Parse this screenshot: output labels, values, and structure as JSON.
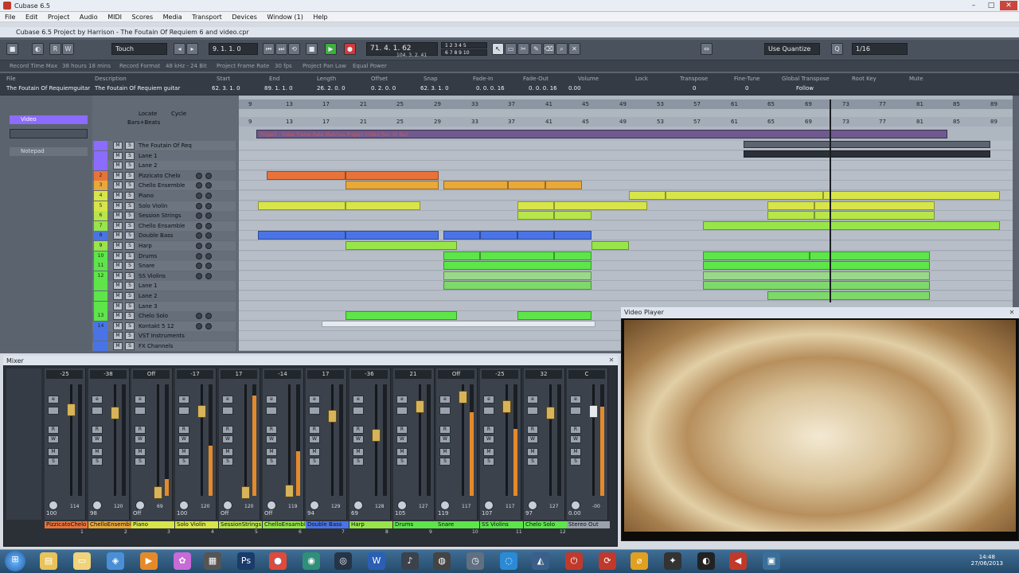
{
  "app": {
    "title": "Cubase 6.5",
    "window_controls": [
      "–",
      "□",
      "✕"
    ]
  },
  "menubar": {
    "items": [
      "File",
      "Edit",
      "Project",
      "Audio",
      "MIDI",
      "Scores",
      "Media",
      "Transport",
      "Devices",
      "Window (1)",
      "Help"
    ]
  },
  "project": {
    "title": "Cubase 6.5 Project by Harrison - The Foutain Of Requiem 6 and video.cpr",
    "toolbar": {
      "automation_mode": "Touch",
      "position_primary": "9. 1. 1. 0",
      "position_secondary": "89. 1. 1. 0",
      "main_position": "71. 4. 1. 62",
      "main_position_sub": "104. 3. 2. 41",
      "markers_row1": "1 2 3 4 5",
      "markers_row2": "6 7 8 9 10",
      "quantize_mode": "Use Quantize",
      "quantize_value": "1/16"
    },
    "status_bar": {
      "record_time_label": "Record Time Max",
      "record_time_value": "38 hours 18 mins",
      "record_format_label": "Record Format",
      "record_format_value": "48 kHz - 24 Bit",
      "frame_rate_label": "Project Frame Rate",
      "frame_rate_value": "30 fps",
      "pan_law_label": "Project Pan Law",
      "pan_law_value": "Equal Power"
    },
    "infoline": {
      "headers": [
        "File",
        "Description",
        "Start",
        "End",
        "Length",
        "Offset",
        "Snap",
        "Fade-In",
        "Fade-Out",
        "Volume",
        "Lock",
        "Transpose",
        "Fine-Tune",
        "Global Transpose",
        "Root Key",
        "Mute"
      ],
      "values": [
        "The Foutain Of Requiemguitar",
        "The Foutain Of Requiem guitar",
        "62. 3. 1. 0",
        "89. 1. 1. 0",
        "26. 2. 0. 0",
        "0. 2. 0. 0",
        "62. 3. 1. 0",
        "0. 0. 0. 16",
        "0. 0. 0. 16",
        "0.00",
        "",
        "0",
        "0",
        "Follow",
        "",
        ""
      ]
    },
    "inspector": {
      "video_tab": "Video",
      "notepad_tab": "Notepad"
    },
    "track_list_header": {
      "locate": "Locate",
      "cycle": "Cycle",
      "ruler_format": "Bars+Beats"
    },
    "tracks": [
      {
        "num": "",
        "name": "The Foutain Of Req",
        "color": "#8b6cff"
      },
      {
        "num": "",
        "name": "Lane 1",
        "color": "#8b6cff"
      },
      {
        "num": "",
        "name": "Lane 2",
        "color": "#8b6cff"
      },
      {
        "num": "2",
        "name": "Pizzicato Chelo",
        "color": "#e8733a"
      },
      {
        "num": "3",
        "name": "Chello Ensemble",
        "color": "#e8a83a"
      },
      {
        "num": "4",
        "name": "Piano",
        "color": "#d8e54a"
      },
      {
        "num": "5",
        "name": "Solo Violin",
        "color": "#d8e54a"
      },
      {
        "num": "6",
        "name": "Session Strings",
        "color": "#b8e54a"
      },
      {
        "num": "7",
        "name": "Chello Ensamble",
        "color": "#98e54a"
      },
      {
        "num": "8",
        "name": "Double Bass",
        "color": "#4a74e5"
      },
      {
        "num": "9",
        "name": "Harp",
        "color": "#98e54a"
      },
      {
        "num": "10",
        "name": "Drums",
        "color": "#5ee54a"
      },
      {
        "num": "11",
        "name": "Snare",
        "color": "#5ee54a"
      },
      {
        "num": "12",
        "name": "SS Violins",
        "color": "#5ee54a"
      },
      {
        "num": "",
        "name": "Lane 1",
        "color": "#5ee54a"
      },
      {
        "num": "",
        "name": "Lane 2",
        "color": "#5ee54a"
      },
      {
        "num": "",
        "name": "Lane 3",
        "color": "#5ee54a"
      },
      {
        "num": "13",
        "name": "Chelo Solo",
        "color": "#5ee54a"
      },
      {
        "num": "14",
        "name": "Kontakt 5 12",
        "color": "#4a74e5"
      },
      {
        "num": "",
        "name": "VST Instruments",
        "color": "#4a74e5"
      },
      {
        "num": "",
        "name": "FX Channels",
        "color": "#4a74e5"
      }
    ],
    "ruler_bars": [
      "9",
      "13",
      "17",
      "21",
      "25",
      "29",
      "33",
      "37",
      "41",
      "45",
      "49",
      "53",
      "57",
      "61",
      "65",
      "69",
      "73",
      "77",
      "81",
      "85",
      "89"
    ],
    "video_track_label": "Project - Video Frame Rate Matches Project (Video fps: 30 fps)"
  },
  "mixer": {
    "title": "Mixer",
    "channels": [
      {
        "name": "PizzicatoChelo",
        "num": "1",
        "top_vol": "-25",
        "bottom_a": "100",
        "bottom_b": "114",
        "color": "#e8733a",
        "meter": 0.0
      },
      {
        "name": "ChelloEnsembl",
        "num": "2",
        "top_vol": "-38",
        "bottom_a": "98",
        "bottom_b": "120",
        "color": "#e8a83a",
        "meter": 0.0
      },
      {
        "name": "Piano",
        "num": "3",
        "top_vol": "Off",
        "bottom_a": "Off",
        "bottom_b": "69",
        "color": "#d8e54a",
        "meter": 0.15
      },
      {
        "name": "Solo Violin",
        "num": "4",
        "top_vol": "-17",
        "bottom_a": "100",
        "bottom_b": "120",
        "color": "#d8e54a",
        "meter": 0.45
      },
      {
        "name": "SessionStrings",
        "num": "5",
        "top_vol": "17",
        "bottom_a": "Off",
        "bottom_b": "120",
        "color": "#b8e54a",
        "meter": 0.9
      },
      {
        "name": "ChelloEnsambl",
        "num": "6",
        "top_vol": "-14",
        "bottom_a": "Off",
        "bottom_b": "119",
        "color": "#98e54a",
        "meter": 0.4
      },
      {
        "name": "Double Bass",
        "num": "7",
        "top_vol": "17",
        "bottom_a": "94",
        "bottom_b": "129",
        "color": "#4a74e5",
        "meter": 0.0
      },
      {
        "name": "Harp",
        "num": "8",
        "top_vol": "-36",
        "bottom_a": "69",
        "bottom_b": "128",
        "color": "#98e54a",
        "meter": 0.0
      },
      {
        "name": "Drums",
        "num": "9",
        "top_vol": "21",
        "bottom_a": "105",
        "bottom_b": "127",
        "color": "#5ee54a",
        "meter": 0.0
      },
      {
        "name": "Snare",
        "num": "10",
        "top_vol": "Off",
        "bottom_a": "119",
        "bottom_b": "117",
        "color": "#5ee54a",
        "meter": 0.75
      },
      {
        "name": "SS Violins",
        "num": "11",
        "top_vol": "-25",
        "bottom_a": "107",
        "bottom_b": "117",
        "color": "#5ee54a",
        "meter": 0.6
      },
      {
        "name": "Chelo Solo",
        "num": "12",
        "top_vol": "32",
        "bottom_a": "97",
        "bottom_b": "127",
        "color": "#5ee54a",
        "meter": 0.0
      },
      {
        "name": "Stereo Out",
        "num": "",
        "top_vol": "C",
        "bottom_a": "0.00",
        "bottom_b": "-00",
        "color": "#9aa3ad",
        "meter": 0.8
      }
    ]
  },
  "video_player": {
    "title": "Video Player"
  },
  "taskbar": {
    "time": "14:48",
    "date": "27/06/2013"
  }
}
